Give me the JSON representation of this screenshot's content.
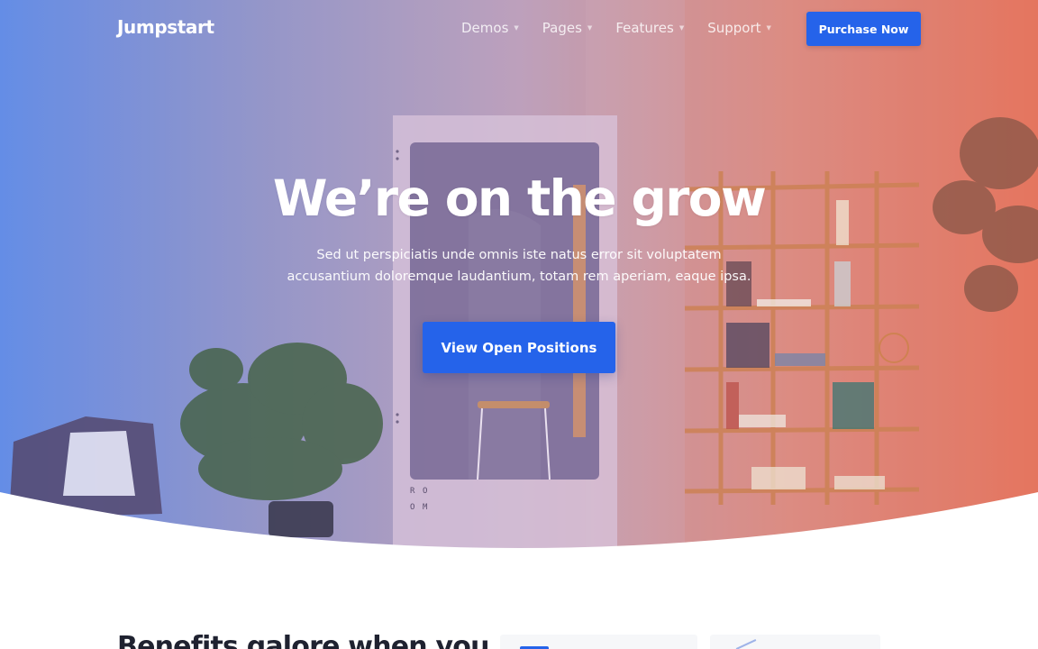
{
  "brand": {
    "name": "Jumpstart"
  },
  "nav": {
    "items": [
      {
        "label": "Demos",
        "caret": "▼"
      },
      {
        "label": "Pages",
        "caret": "▼"
      },
      {
        "label": "Features",
        "caret": "▼"
      },
      {
        "label": "Support",
        "caret": "▼"
      }
    ],
    "cta_label": "Purchase Now"
  },
  "hero": {
    "title": "We’re on the grow",
    "subtitle_line1": "Sed ut perspiciatis unde omnis iste natus error sit voluptatem",
    "subtitle_line2": "accusantium doloremque laudantium, totam rem aperiam, eaque ipsa.",
    "cta_label": "View Open Positions",
    "booth_sign": [
      "R",
      "O",
      "O",
      "M"
    ]
  },
  "section": {
    "heading": "Benefits galore when you"
  },
  "colors": {
    "primary": "#2563ea",
    "gradient_left": "#5b86e5",
    "gradient_right": "#e5674e",
    "heading_text": "#1f2230"
  }
}
